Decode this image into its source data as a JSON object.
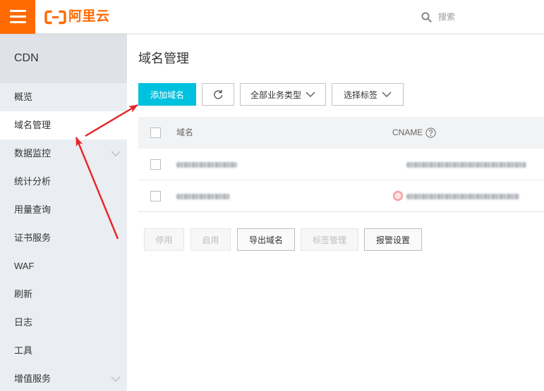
{
  "theme": {
    "brand": "#ff6a00",
    "primary": "#00c1de",
    "annotation": "#e5252a"
  },
  "topbar": {
    "menu_icon": "menu-icon",
    "logo_icon": "alibaba-cloud-logo-icon",
    "logo_text": "阿里云",
    "search": {
      "icon": "search-icon",
      "placeholder": "搜索"
    }
  },
  "sidebar": {
    "title": "CDN",
    "items": [
      {
        "label": "概览"
      },
      {
        "label": "域名管理",
        "active": true
      },
      {
        "label": "数据监控",
        "expandable": true,
        "icon": "chevron-down-icon"
      },
      {
        "label": "统计分析"
      },
      {
        "label": "用量查询"
      },
      {
        "label": "证书服务"
      },
      {
        "label": "WAF"
      },
      {
        "label": "刷新"
      },
      {
        "label": "日志"
      },
      {
        "label": "工具"
      },
      {
        "label": "增值服务",
        "expandable": true,
        "icon": "chevron-down-icon"
      }
    ]
  },
  "main": {
    "title": "域名管理",
    "toolbar": {
      "add_label": "添加域名",
      "refresh_icon": "refresh-icon",
      "type_filter": "全部业务类型",
      "tag_filter": "选择标签",
      "dropdown_icon": "chevron-down-icon"
    },
    "table": {
      "columns": [
        "域名",
        "CNAME"
      ],
      "cname_help_icon": "question-circle-icon",
      "rows": [
        {
          "domain_redacted": true,
          "cname_redacted": true
        },
        {
          "domain_redacted": true,
          "cname_redacted": true,
          "cname_status_icon": "status-circle-icon"
        }
      ]
    },
    "batch_actions": [
      {
        "label": "停用",
        "disabled": true
      },
      {
        "label": "启用",
        "disabled": true
      },
      {
        "label": "导出域名",
        "disabled": false
      },
      {
        "label": "标签管理",
        "disabled": true
      },
      {
        "label": "报警设置",
        "disabled": false
      }
    ]
  }
}
